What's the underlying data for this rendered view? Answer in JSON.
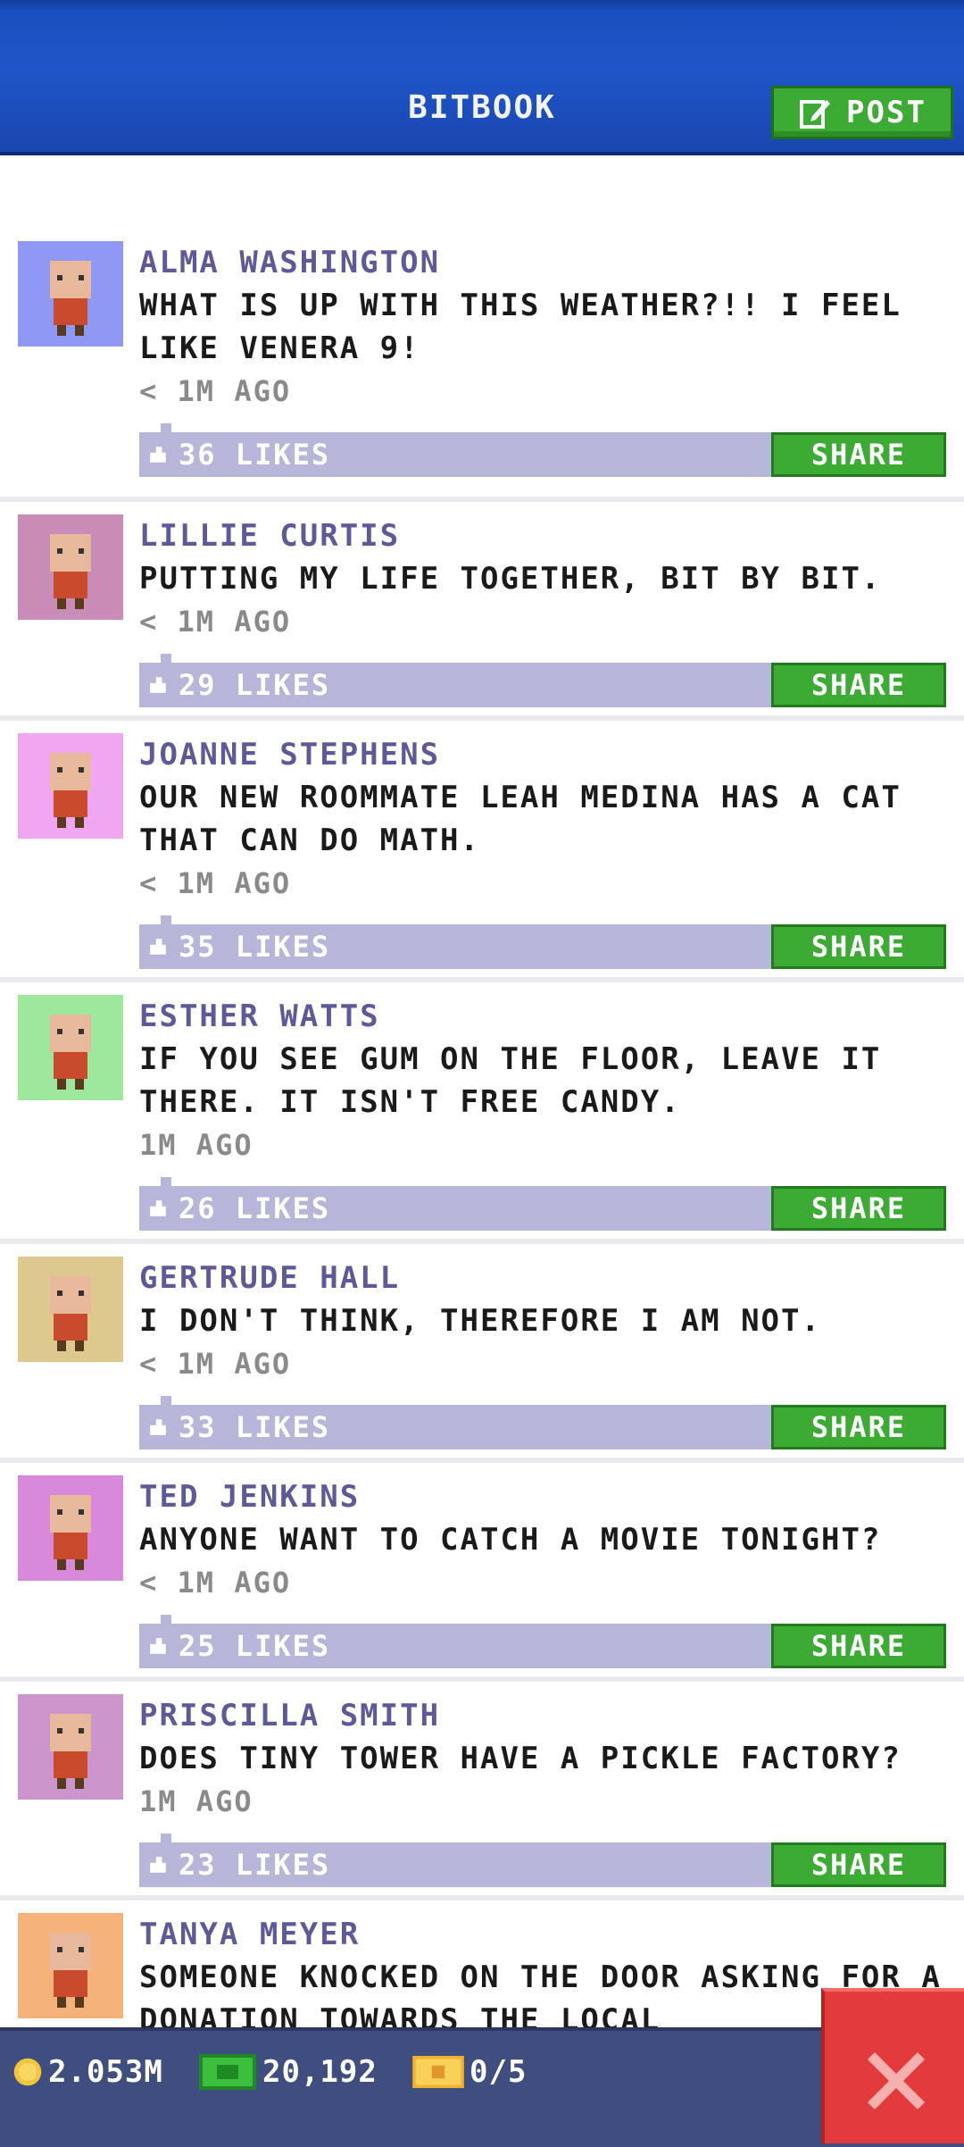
{
  "header": {
    "title": "BITBOOK",
    "post_label": "POST"
  },
  "posts": [
    {
      "name": "ALMA WASHINGTON",
      "message": "WHAT IS UP WITH THIS WEATHER?!! I FEEL LIKE VENERA 9!",
      "time": "< 1M AGO",
      "likes": "36 LIKES",
      "share": "SHARE",
      "avatar_bg": "#8f98f2"
    },
    {
      "name": "LILLIE CURTIS",
      "message": "PUTTING MY LIFE TOGETHER, BIT BY BIT.",
      "time": "< 1M AGO",
      "likes": "29 LIKES",
      "share": "SHARE",
      "avatar_bg": "#c98cb6"
    },
    {
      "name": "JOANNE STEPHENS",
      "message": "OUR NEW ROOMMATE LEAH MEDINA HAS A CAT THAT CAN DO MATH.",
      "time": "< 1M AGO",
      "likes": "35 LIKES",
      "share": "SHARE",
      "avatar_bg": "#f0a6f0"
    },
    {
      "name": "ESTHER WATTS",
      "message": "IF YOU SEE GUM ON THE FLOOR, LEAVE IT THERE. IT ISN'T FREE CANDY.",
      "time": "1M AGO",
      "likes": "26 LIKES",
      "share": "SHARE",
      "avatar_bg": "#9ee89e"
    },
    {
      "name": "GERTRUDE HALL",
      "message": "I DON'T THINK, THEREFORE I AM NOT.",
      "time": "< 1M AGO",
      "likes": "33 LIKES",
      "share": "SHARE",
      "avatar_bg": "#ddc98e"
    },
    {
      "name": "TED JENKINS",
      "message": "ANYONE WANT TO CATCH A MOVIE TONIGHT?",
      "time": "< 1M AGO",
      "likes": "25 LIKES",
      "share": "SHARE",
      "avatar_bg": "#d989d9"
    },
    {
      "name": "PRISCILLA SMITH",
      "message": "DOES TINY TOWER HAVE A PICKLE FACTORY?",
      "time": "1M AGO",
      "likes": "23 LIKES",
      "share": "SHARE",
      "avatar_bg": "#cc95cc"
    },
    {
      "name": "TANYA MEYER",
      "message": "SOMEONE KNOCKED ON THE DOOR ASKING FOR A DONATION TOWARDS THE LOCAL",
      "time": "",
      "likes": "",
      "share": "",
      "avatar_bg": "#f5b27a"
    }
  ],
  "status": {
    "coins": "2.053M",
    "bux": "20,192",
    "tickets": "0/5"
  },
  "icons": {
    "post": "edit-icon",
    "close": "close-icon",
    "coin": "coin-icon",
    "bux": "bux-icon",
    "ticket": "ticket-icon",
    "like": "thumb-icon"
  },
  "colors": {
    "header": "#1f55c8",
    "button_green": "#3cab34",
    "likes_bar": "#b5b6d8",
    "close_red": "#e33b3b",
    "status_bar": "#3f4e7e"
  }
}
